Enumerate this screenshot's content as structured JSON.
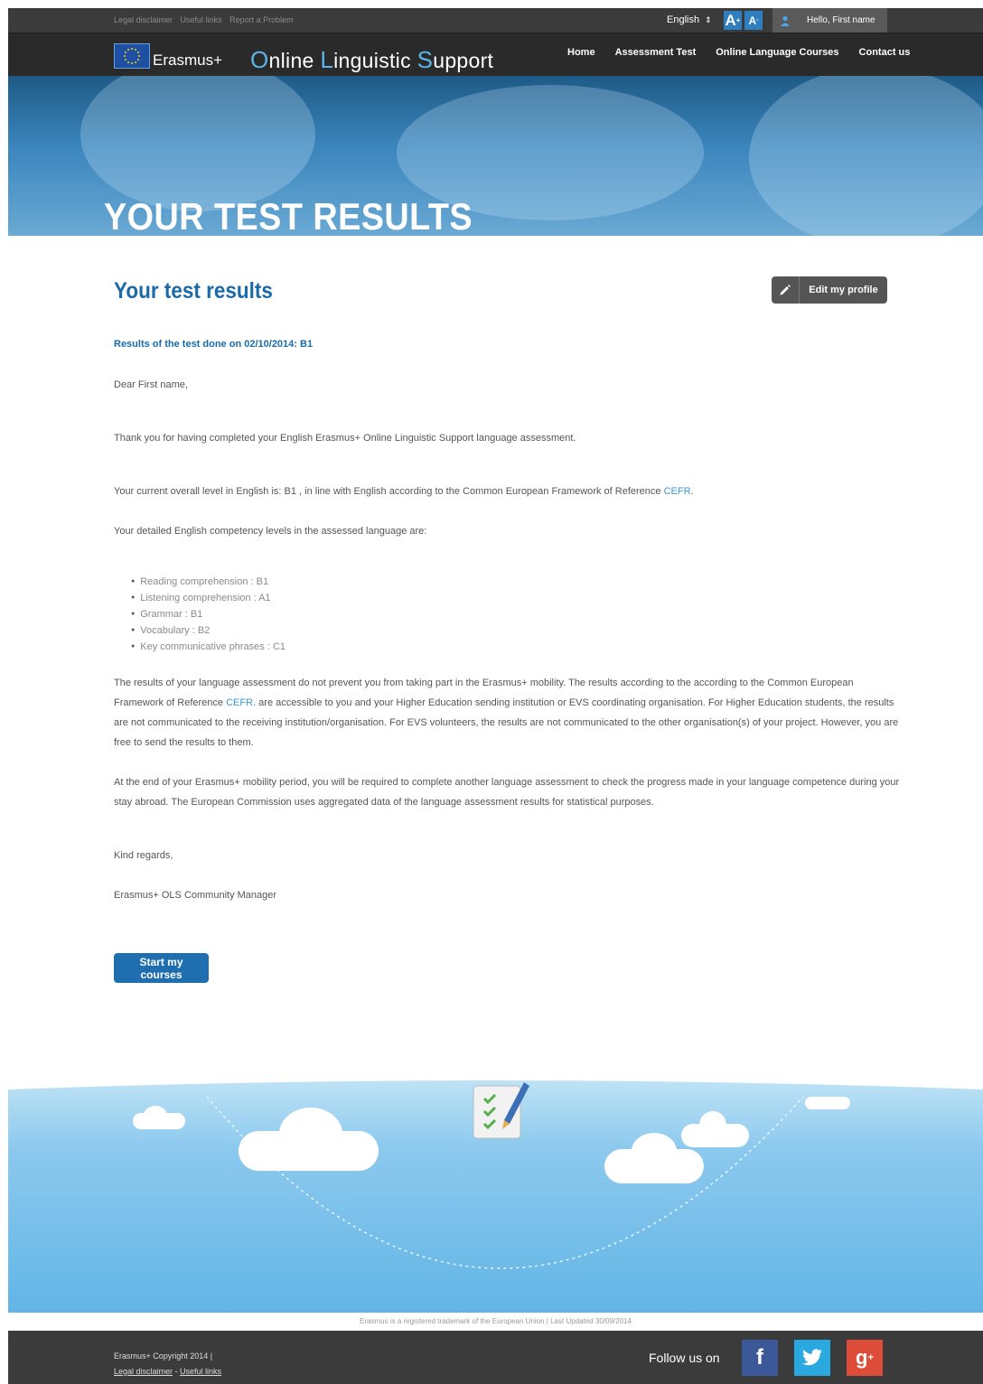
{
  "topbar": {
    "links": [
      "Legal disclaimer",
      "Useful links",
      "Report a Problem"
    ],
    "language": "English",
    "font_larger": "A+",
    "font_smaller": "A-",
    "greeting": "Hello, First name"
  },
  "header": {
    "brand": "Erasmus+",
    "site_title_parts": [
      "O",
      "nline ",
      "L",
      "inguistic ",
      "S",
      "upport"
    ],
    "nav": [
      "Home",
      "Assessment Test",
      "Online Language Courses",
      "Contact us"
    ]
  },
  "hero": {
    "title": "YOUR TEST RESULTS"
  },
  "main": {
    "title": "Your test results",
    "edit_profile": "Edit my profile",
    "subheading": "Results of the test done on 02/10/2014: B1",
    "greeting": "Dear First name,",
    "thanks": "Thank you for having completed your English Erasmus+ Online Linguistic Support language assessment.",
    "overall_prefix": "Your current overall level in English is: B1 , in line with English according to the Common European Framework of Reference ",
    "cefr_link": "CEFR",
    "overall_suffix": ".",
    "detailed": "Your detailed English competency levels in the assessed language are:",
    "skills": [
      "Reading comprehension : B1",
      "Listening comprehension : A1",
      "Grammar : B1",
      "Vocabulary : B2",
      "Key communicative phrases : C1"
    ],
    "results_part1": "The results of your language assessment do not prevent you from taking part in the Erasmus+ mobility. The results according to the according to the Common European Framework of Reference ",
    "results_part2": ". are accessible to you and your Higher Education sending institution or EVS coordinating organisation. For Higher Education students, the results are not communicated to the receiving institution/organisation. For EVS volunteers, the results are not communicated to the other organisation(s) of your project. However, you are free to send the results to them.",
    "end_mobility": "At the end of your Erasmus+ mobility period, you will be required to complete another language assessment to check the progress made in your language competence during your stay abroad. The European Commission uses aggregated data of the language assessment results for statistical purposes.",
    "regards": "Kind regards,",
    "signature": "Erasmus+ OLS Community Manager",
    "start_courses": "Start my courses"
  },
  "footer": {
    "trademark": "Erasmus is a registered trademark of the European Union | Last Updated 30/09/2014",
    "copyright": "Erasmus+ Copyright 2014 |",
    "legal": "Legal disclaimer",
    "separator": " - ",
    "useful": "Useful links",
    "follow": "Follow us on",
    "social": [
      {
        "name": "facebook",
        "glyph": "f",
        "color": "#3b5998"
      },
      {
        "name": "twitter",
        "glyph": "t",
        "color": "#2aa9e0"
      },
      {
        "name": "google-plus",
        "glyph": "g+",
        "color": "#dd4b39"
      }
    ]
  },
  "colors": {
    "accent": "#1a6aa8",
    "link": "#3a96d8",
    "bar": "#3b3b3b"
  }
}
